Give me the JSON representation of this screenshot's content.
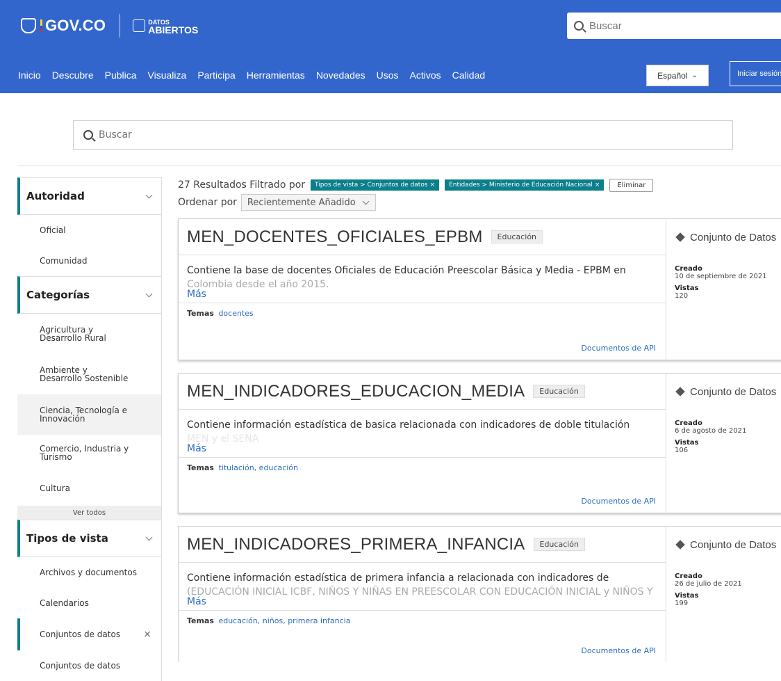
{
  "header": {
    "govco": "GOV.CO",
    "datos_small": "DATOS",
    "datos_big": "ABIERTOS",
    "search_placeholder": "Buscar",
    "nav": [
      "Inicio",
      "Descubre",
      "Publica",
      "Visualiza",
      "Participa",
      "Herramientas",
      "Novedades",
      "Usos",
      "Activos",
      "Calidad"
    ],
    "language": "Español",
    "login": "Iniciar sesión",
    "colors": {
      "bar": "#3366cc",
      "accent": "#0b7f8a"
    }
  },
  "search": {
    "placeholder": "Buscar"
  },
  "results": {
    "count_text": "27 Resultados Filtrado por",
    "chips": [
      "Tipos de vista > Conjuntos de datos",
      "Entidades > Ministerio de Educación Nacional"
    ],
    "eliminar": "Eliminar",
    "sort_label": "Ordenar por",
    "sort_value": "Recientemente Añadido"
  },
  "sidebar": {
    "autoridad": {
      "title": "Autoridad",
      "items": [
        "Oficial",
        "Comunidad"
      ]
    },
    "categorias": {
      "title": "Categorías",
      "items": [
        "Agricultura y Desarrollo Rural",
        "Ambiente y Desarrollo Sostenible",
        "Ciencia, Tecnología e Innovación",
        "Comercio, Industria y Turismo",
        "Cultura"
      ],
      "ver_todos": "Ver todos"
    },
    "tipos": {
      "title": "Tipos de vista",
      "items": [
        "Archivos y documentos",
        "Calendarios",
        "Conjuntos de datos",
        "Conjuntos de datos"
      ]
    }
  },
  "cards": [
    {
      "title": "MEN_DOCENTES_OFICIALES_EPBM",
      "category": "Educación",
      "desc1": "Contiene la base de docentes Oficiales de Educación Preescolar Básica y Media - EPBM en",
      "desc2": "Colombia desde el año 2015.",
      "mas": "Más",
      "temas_label": "Temas",
      "temas": "docentes",
      "api": "Documentos de API",
      "type": "Conjunto de Datos",
      "creado_label": "Creado",
      "creado": "10 de septiembre de 2021",
      "vistas_label": "Vistas",
      "vistas": "120"
    },
    {
      "title": "MEN_INDICADORES_EDUCACION_MEDIA",
      "category": "Educación",
      "desc1": "Contiene información estadística de basica relacionada con indicadores de doble titulación",
      "desc2": "MEN y el SENA",
      "mas": "Más",
      "temas_label": "Temas",
      "temas": "titulación, educación",
      "api": "Documentos de API",
      "type": "Conjunto de Datos",
      "creado_label": "Creado",
      "creado": "6 de agosto de 2021",
      "vistas_label": "Vistas",
      "vistas": "106"
    },
    {
      "title": "MEN_INDICADORES_PRIMERA_INFANCIA",
      "category": "Educación",
      "desc1": "Contiene información estadística de primera infancia a relacionada con indicadores de",
      "desc2": "(EDUCACIÓN INICIAL ICBF, NIÑOS Y NIÑAS EN PREESCOLAR CON EDUCACIÓN INICIAL y NIÑOS Y",
      "mas": "Más",
      "temas_label": "Temas",
      "temas": "educación, niños, primera infancia",
      "api": "Documentos de API",
      "type": "Conjunto de Datos",
      "creado_label": "Creado",
      "creado": "26 de julio de 2021",
      "vistas_label": "Vistas",
      "vistas": "199"
    }
  ]
}
